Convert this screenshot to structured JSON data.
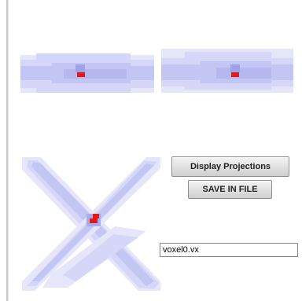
{
  "controls": {
    "display_projections_label": "Display Projections",
    "save_in_file_label": "SAVE IN FILE",
    "filename_value": "voxel0.vx"
  },
  "colors": {
    "voxel_light": "#e6e6fa",
    "voxel_mid": "#cfd0f6",
    "voxel_dark": "#b9bbf0",
    "voxel_core": "#a9acec",
    "selected_voxel": "#e01a1a",
    "button_face": "#dcdcdc",
    "page_background": "#ffffff"
  }
}
